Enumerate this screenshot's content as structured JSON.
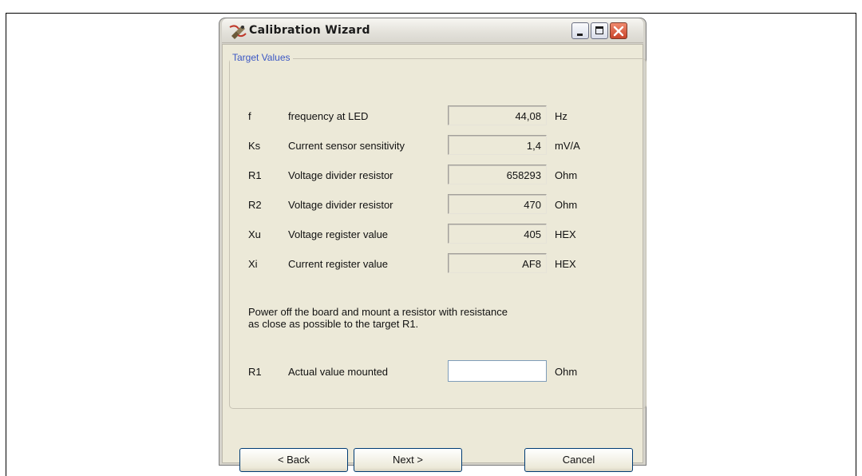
{
  "window": {
    "title": "Calibration Wizard"
  },
  "group": {
    "legend": "Target Values"
  },
  "target_rows": [
    {
      "symbol": "f",
      "label": "frequency at LED",
      "value": "44,08",
      "unit": "Hz"
    },
    {
      "symbol": "Ks",
      "label": "Current sensor sensitivity",
      "value": "1,4",
      "unit": "mV/A"
    },
    {
      "symbol": "R1",
      "label": "Voltage divider resistor",
      "value": "658293",
      "unit": "Ohm"
    },
    {
      "symbol": "R2",
      "label": "Voltage divider resistor",
      "value": "470",
      "unit": "Ohm"
    },
    {
      "symbol": "Xu",
      "label": "Voltage register value",
      "value": "405",
      "unit": "HEX"
    },
    {
      "symbol": "Xi",
      "label": "Current register value",
      "value": "AF8",
      "unit": "HEX"
    }
  ],
  "instruction": {
    "line1": "Power off the board and mount a resistor with resistance",
    "line2": "as close as possible to the target R1."
  },
  "actual_row": {
    "symbol": "R1",
    "label": "Actual value mounted",
    "value": "",
    "unit": "Ohm"
  },
  "buttons": {
    "back": "< Back",
    "next": "Next >",
    "cancel": "Cancel"
  },
  "icons": {
    "app": "calibration-probe-icon",
    "minimize": "minimize-icon",
    "maximize": "maximize-icon",
    "close": "close-icon"
  },
  "colors": {
    "legend": "#3b57c4",
    "client_bg": "#ece9d8",
    "close_btn": "#c8442a"
  }
}
